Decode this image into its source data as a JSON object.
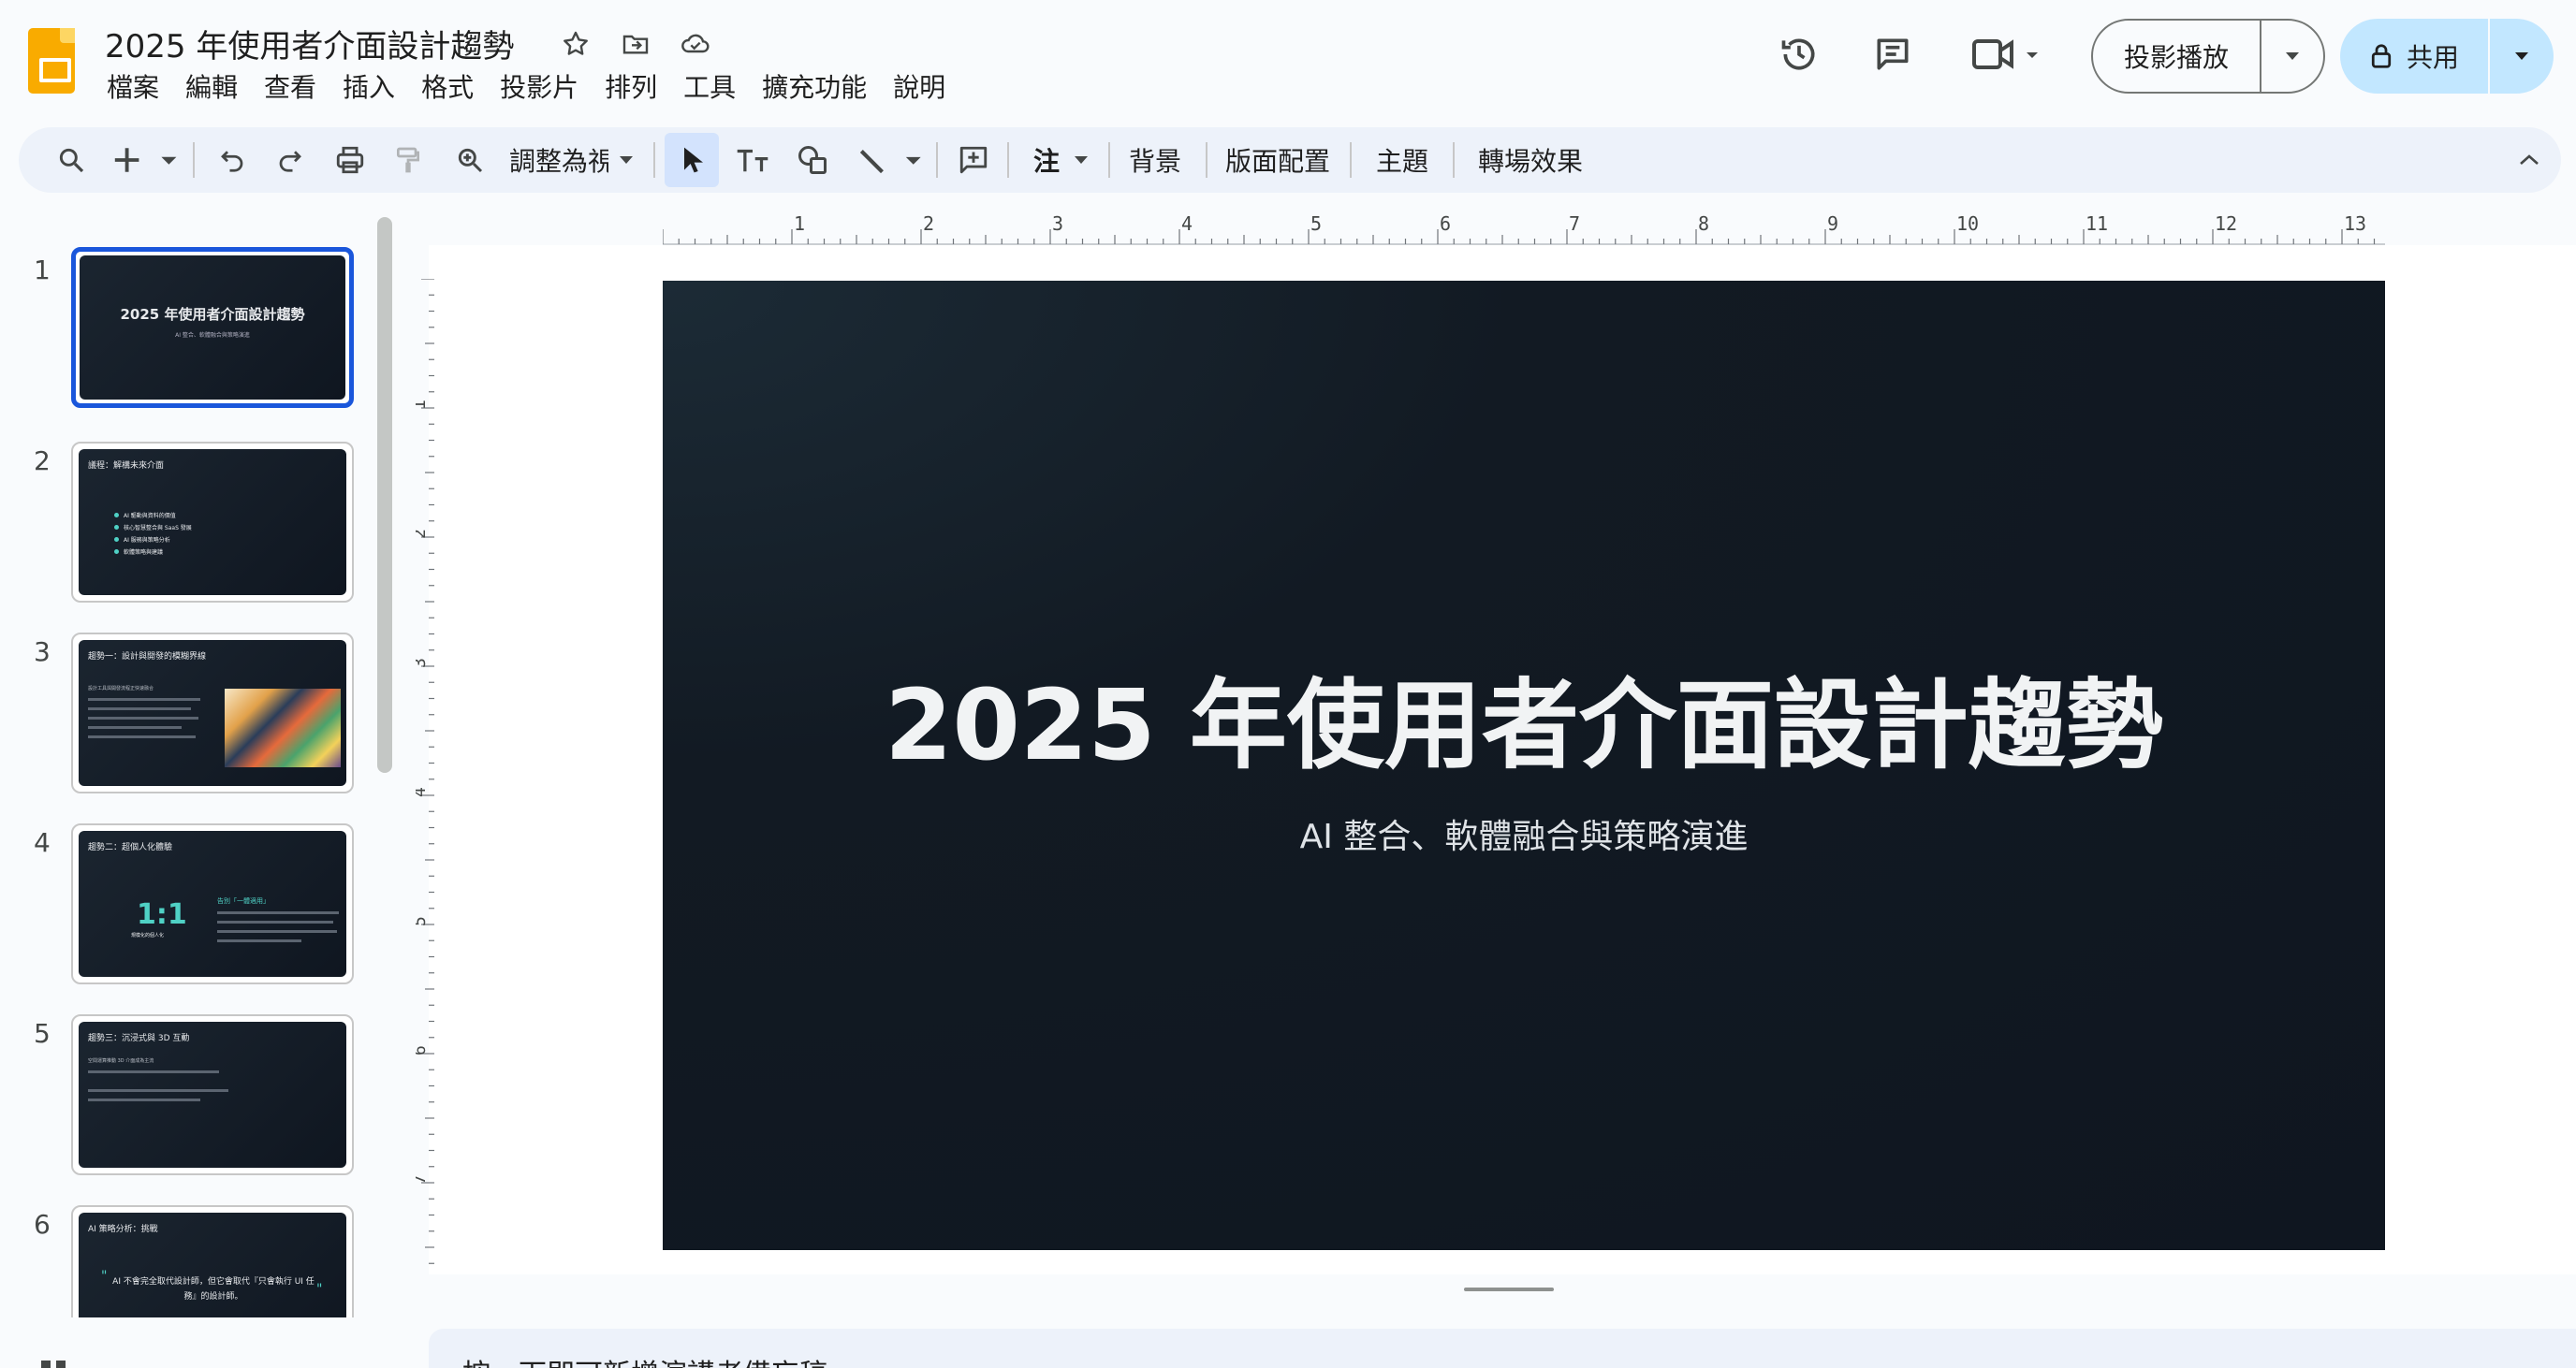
{
  "app": {
    "doc_title": "2025 年使用者介面設計趨勢",
    "menus": [
      "檔案",
      "編輯",
      "查看",
      "插入",
      "格式",
      "投影片",
      "排列",
      "工具",
      "擴充功能",
      "說明"
    ],
    "present_label": "投影播放",
    "share_label": "共用"
  },
  "toolbar": {
    "zoom_label": "調整為視",
    "note_label": "注",
    "background_label": "背景",
    "layout_label": "版面配置",
    "theme_label": "主題",
    "transition_label": "轉場效果"
  },
  "filmstrip": {
    "slides": [
      {
        "num": "1",
        "title": "2025 年使用者介面設計趨勢",
        "sub": "AI 整合、軟體融合與策略演進"
      },
      {
        "num": "2",
        "title": "議程：解構未來介面",
        "bullets": [
          "AI 驅動與資料的價值",
          "核心智慧整合與 SaaS 發展",
          "AI 服務與策略分析",
          "軟體策略與建議"
        ]
      },
      {
        "num": "3",
        "title": "趨勢一：設計與開發的模糊界線",
        "text": "設計工具與開發流程正快速融合"
      },
      {
        "num": "4",
        "title": "趨勢二：超個人化體驗",
        "big": "1:1",
        "bigsub": "規模化的個人化",
        "side": "告別「一體適用」"
      },
      {
        "num": "5",
        "title": "趨勢三：沉浸式與 3D 互動",
        "text": "空間運算推動 3D 介面成為主流"
      },
      {
        "num": "6",
        "title": "AI 策略分析：挑戰",
        "quote": "AI 不會完全取代設計師，但它會取代『只會執行 UI 任務』的設計師。"
      }
    ]
  },
  "ruler": {
    "top_labels": [
      "1",
      "2",
      "3",
      "4",
      "5",
      "6",
      "7",
      "8",
      "9",
      "10",
      "11",
      "12",
      "13"
    ],
    "left_labels": [
      "1",
      "2",
      "3",
      "4",
      "5",
      "6",
      "7"
    ]
  },
  "slide": {
    "title": "2025 年使用者介面設計趨勢",
    "subtitle": "AI 整合、軟體融合與策略演進"
  },
  "notes": {
    "placeholder": "按一下即可新增演講者備忘稿"
  },
  "colors": {
    "accent": "#1a56db",
    "share_bg": "#c2e7ff",
    "toolbar_bg": "#edf2fa",
    "slide_bg": "#0f1620",
    "teal": "#4fd1c5"
  }
}
